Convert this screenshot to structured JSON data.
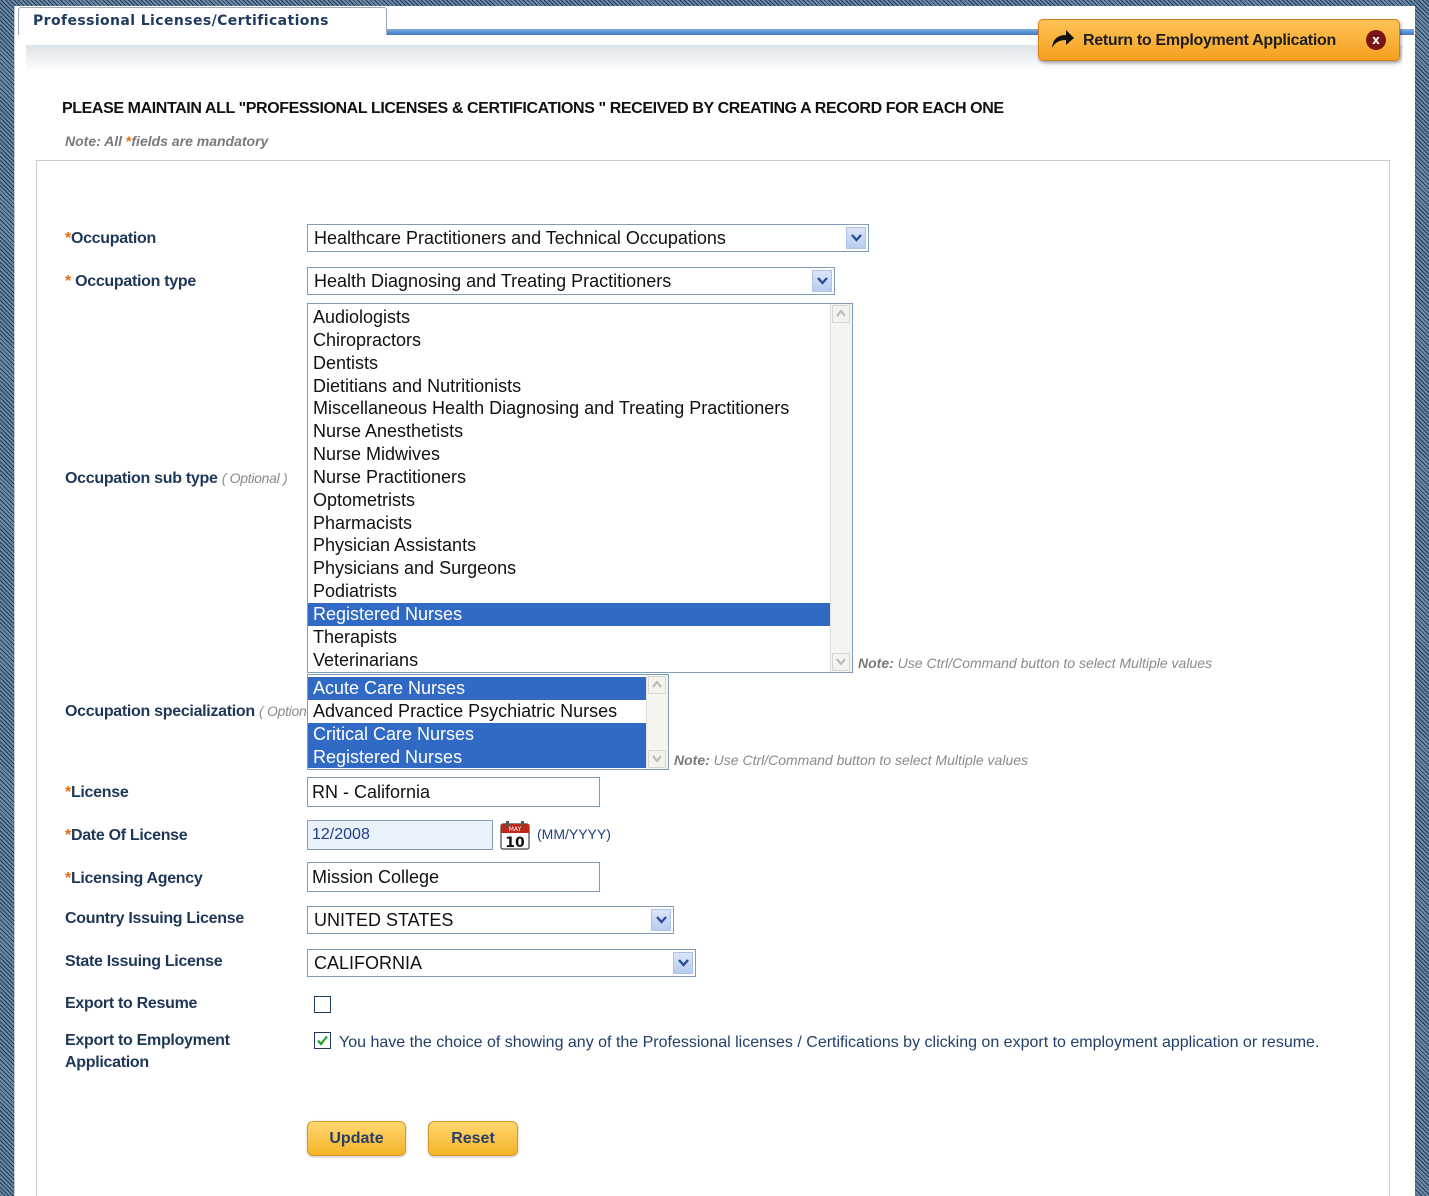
{
  "tab": {
    "title": "Professional Licenses/Certifications"
  },
  "return_button": {
    "label": "Return to Employment Application"
  },
  "heading": "PLEASE MAINTAIN ALL \"PROFESSIONAL LICENSES & CERTIFICATIONS \" RECEIVED BY CREATING A RECORD FOR EACH ONE",
  "mandatory_note": {
    "prefix": "Note: All",
    "star": "*",
    "suffix": "fields are mandatory"
  },
  "form": {
    "occupation": {
      "label": "Occupation",
      "value": "Healthcare Practitioners and Technical Occupations"
    },
    "occupation_type": {
      "label": "Occupation type",
      "value": "Health Diagnosing and Treating Practitioners"
    },
    "occupation_sub_type": {
      "label": "Occupation sub type",
      "optional": "( Optional )",
      "options": [
        {
          "text": "Audiologists",
          "selected": false
        },
        {
          "text": "Chiropractors",
          "selected": false
        },
        {
          "text": "Dentists",
          "selected": false
        },
        {
          "text": "Dietitians and Nutritionists",
          "selected": false
        },
        {
          "text": "Miscellaneous Health Diagnosing and Treating Practitioners",
          "selected": false
        },
        {
          "text": "Nurse Anesthetists",
          "selected": false
        },
        {
          "text": "Nurse Midwives",
          "selected": false
        },
        {
          "text": "Nurse Practitioners",
          "selected": false
        },
        {
          "text": "Optometrists",
          "selected": false
        },
        {
          "text": "Pharmacists",
          "selected": false
        },
        {
          "text": "Physician Assistants",
          "selected": false
        },
        {
          "text": "Physicians and Surgeons",
          "selected": false
        },
        {
          "text": "Podiatrists",
          "selected": false
        },
        {
          "text": "Registered Nurses",
          "selected": true
        },
        {
          "text": "Therapists",
          "selected": false
        },
        {
          "text": "Veterinarians",
          "selected": false
        }
      ],
      "note_bold": "Note:",
      "note": "Use Ctrl/Command button to select Multiple values"
    },
    "occupation_specialization": {
      "label": "Occupation specialization",
      "optional": "( Optional )",
      "options": [
        {
          "text": "Acute Care Nurses",
          "selected": true
        },
        {
          "text": "Advanced Practice Psychiatric Nurses",
          "selected": false
        },
        {
          "text": "Critical Care Nurses",
          "selected": true
        },
        {
          "text": "Registered Nurses",
          "selected": true
        }
      ],
      "note_bold": "Note:",
      "note": "Use Ctrl/Command button to select Multiple values"
    },
    "license": {
      "label": "License",
      "value": "RN - California"
    },
    "date_of_license": {
      "label": "Date Of License",
      "value": "12/2008",
      "hint": "(MM/YYYY)",
      "calendar_month": "MAY",
      "calendar_day": "10"
    },
    "licensing_agency": {
      "label": "Licensing Agency",
      "value": "Mission College"
    },
    "country": {
      "label": "Country Issuing License",
      "value": "UNITED STATES"
    },
    "state": {
      "label": "State Issuing License",
      "value": "CALIFORNIA"
    },
    "export_resume": {
      "label": "Export to Resume",
      "checked": false
    },
    "export_employment": {
      "label_line1": "Export to Employment",
      "label_line2": "Application",
      "checked": true,
      "text": "You have the choice of showing any of the Professional licenses / Certifications by clicking on export to employment application or resume."
    }
  },
  "buttons": {
    "update": "Update",
    "reset": "Reset"
  },
  "colors": {
    "accent": "#316ac5",
    "button": "#f5b327",
    "required_star": "#ea6a10"
  }
}
